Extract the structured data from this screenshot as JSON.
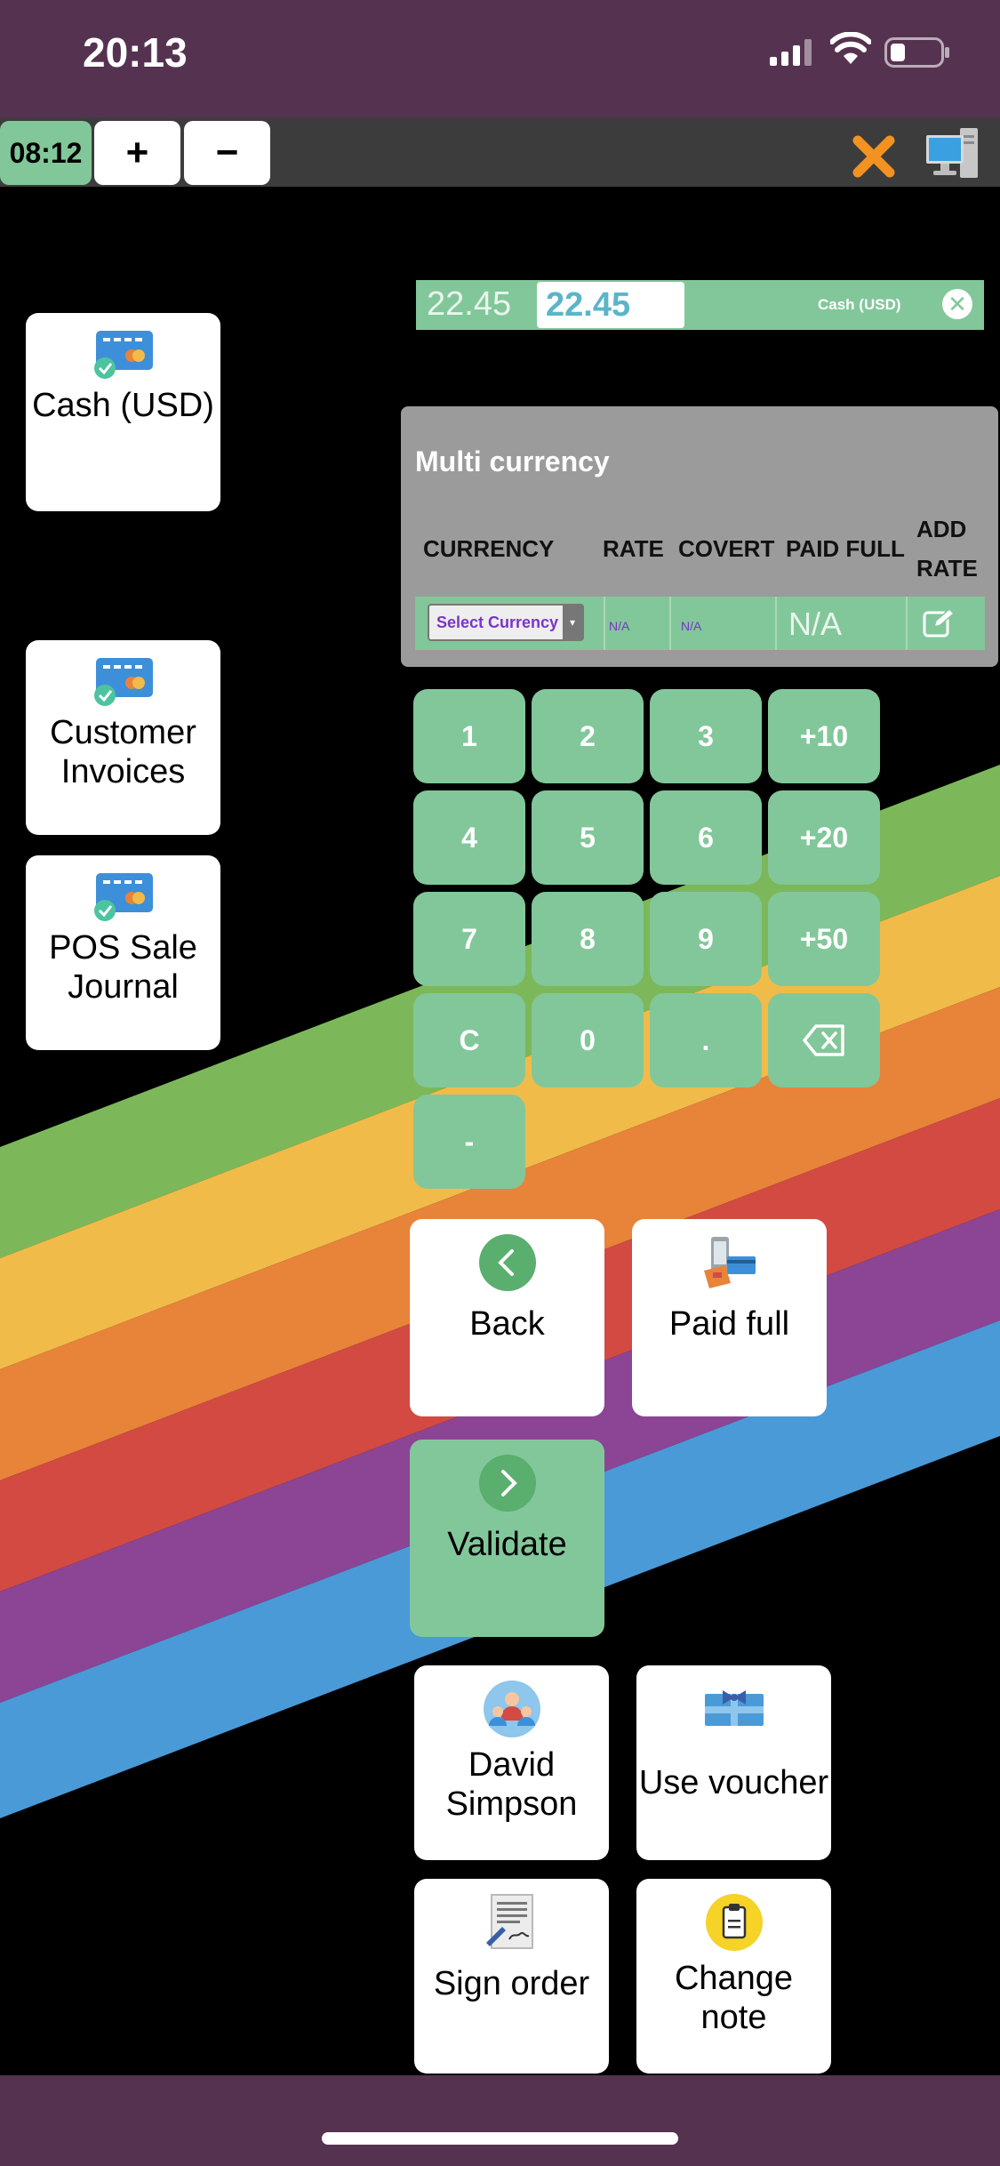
{
  "status_bar": {
    "time": "20:13"
  },
  "toolbar": {
    "session_time": "08:12",
    "plus_label": "+",
    "minus_label": "−",
    "close_icon": "close-icon",
    "screen_icon": "monitor-icon"
  },
  "payment_methods": [
    {
      "label": "Cash (USD)",
      "icon": "card-icon"
    },
    {
      "label": "Customer Invoices",
      "icon": "card-icon"
    },
    {
      "label": "POS Sale Journal",
      "icon": "card-icon"
    }
  ],
  "amount_bar": {
    "due": "22.45",
    "tendered": "22.45",
    "method": "Cash (USD)"
  },
  "multi_currency": {
    "title": "Multi currency",
    "headers": {
      "currency": "CURRENCY",
      "rate": "RATE",
      "covert": "COVERT",
      "paid_full": "PAID FULL",
      "add_rate_1": "ADD",
      "add_rate_2": "RATE"
    },
    "row": {
      "select_placeholder": "Select Currency",
      "rate": "N/A",
      "covert": "N/A",
      "paid_full": "N/A"
    }
  },
  "numpad": [
    "1",
    "2",
    "3",
    "+10",
    "4",
    "5",
    "6",
    "+20",
    "7",
    "8",
    "9",
    "+50",
    "C",
    "0",
    ".",
    "backspace",
    "-"
  ],
  "actions": {
    "back": "Back",
    "paid_full": "Paid full",
    "validate": "Validate",
    "customer": "David Simpson",
    "voucher": "Use voucher",
    "sign_order": "Sign order",
    "change_note": "Change note"
  },
  "colors": {
    "status_bar": "#553350",
    "toolbar": "#3c3c3c",
    "accent_green": "#82c79a",
    "panel_grey": "#9b9b9b",
    "close_orange": "#f39221",
    "rainbow": [
      "#7cb85a",
      "#f1bb4a",
      "#e8833a",
      "#d24a42",
      "#8c4494",
      "#4a9ad8"
    ]
  }
}
